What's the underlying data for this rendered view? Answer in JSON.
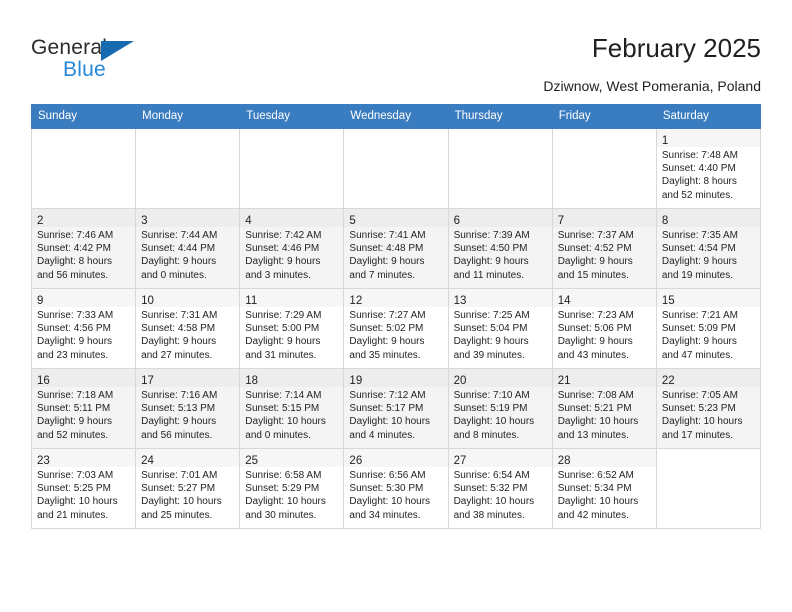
{
  "brand": {
    "name_top": "General",
    "name_bottom": "Blue",
    "accent_color": "#2787d6",
    "triangle_color": "#1769b0"
  },
  "header": {
    "title": "February 2025",
    "subtitle": "Dziwnow, West Pomerania, Poland"
  },
  "calendar": {
    "header_bg": "#3a7cc0",
    "weekday_headers": [
      "Sunday",
      "Monday",
      "Tuesday",
      "Wednesday",
      "Thursday",
      "Friday",
      "Saturday"
    ],
    "weeks": [
      [
        {
          "day": "",
          "lines": []
        },
        {
          "day": "",
          "lines": []
        },
        {
          "day": "",
          "lines": []
        },
        {
          "day": "",
          "lines": []
        },
        {
          "day": "",
          "lines": []
        },
        {
          "day": "",
          "lines": []
        },
        {
          "day": "1",
          "lines": [
            "Sunrise: 7:48 AM",
            "Sunset: 4:40 PM",
            "Daylight: 8 hours",
            "and 52 minutes."
          ]
        }
      ],
      [
        {
          "day": "2",
          "lines": [
            "Sunrise: 7:46 AM",
            "Sunset: 4:42 PM",
            "Daylight: 8 hours",
            "and 56 minutes."
          ]
        },
        {
          "day": "3",
          "lines": [
            "Sunrise: 7:44 AM",
            "Sunset: 4:44 PM",
            "Daylight: 9 hours",
            "and 0 minutes."
          ]
        },
        {
          "day": "4",
          "lines": [
            "Sunrise: 7:42 AM",
            "Sunset: 4:46 PM",
            "Daylight: 9 hours",
            "and 3 minutes."
          ]
        },
        {
          "day": "5",
          "lines": [
            "Sunrise: 7:41 AM",
            "Sunset: 4:48 PM",
            "Daylight: 9 hours",
            "and 7 minutes."
          ]
        },
        {
          "day": "6",
          "lines": [
            "Sunrise: 7:39 AM",
            "Sunset: 4:50 PM",
            "Daylight: 9 hours",
            "and 11 minutes."
          ]
        },
        {
          "day": "7",
          "lines": [
            "Sunrise: 7:37 AM",
            "Sunset: 4:52 PM",
            "Daylight: 9 hours",
            "and 15 minutes."
          ]
        },
        {
          "day": "8",
          "lines": [
            "Sunrise: 7:35 AM",
            "Sunset: 4:54 PM",
            "Daylight: 9 hours",
            "and 19 minutes."
          ]
        }
      ],
      [
        {
          "day": "9",
          "lines": [
            "Sunrise: 7:33 AM",
            "Sunset: 4:56 PM",
            "Daylight: 9 hours",
            "and 23 minutes."
          ]
        },
        {
          "day": "10",
          "lines": [
            "Sunrise: 7:31 AM",
            "Sunset: 4:58 PM",
            "Daylight: 9 hours",
            "and 27 minutes."
          ]
        },
        {
          "day": "11",
          "lines": [
            "Sunrise: 7:29 AM",
            "Sunset: 5:00 PM",
            "Daylight: 9 hours",
            "and 31 minutes."
          ]
        },
        {
          "day": "12",
          "lines": [
            "Sunrise: 7:27 AM",
            "Sunset: 5:02 PM",
            "Daylight: 9 hours",
            "and 35 minutes."
          ]
        },
        {
          "day": "13",
          "lines": [
            "Sunrise: 7:25 AM",
            "Sunset: 5:04 PM",
            "Daylight: 9 hours",
            "and 39 minutes."
          ]
        },
        {
          "day": "14",
          "lines": [
            "Sunrise: 7:23 AM",
            "Sunset: 5:06 PM",
            "Daylight: 9 hours",
            "and 43 minutes."
          ]
        },
        {
          "day": "15",
          "lines": [
            "Sunrise: 7:21 AM",
            "Sunset: 5:09 PM",
            "Daylight: 9 hours",
            "and 47 minutes."
          ]
        }
      ],
      [
        {
          "day": "16",
          "lines": [
            "Sunrise: 7:18 AM",
            "Sunset: 5:11 PM",
            "Daylight: 9 hours",
            "and 52 minutes."
          ]
        },
        {
          "day": "17",
          "lines": [
            "Sunrise: 7:16 AM",
            "Sunset: 5:13 PM",
            "Daylight: 9 hours",
            "and 56 minutes."
          ]
        },
        {
          "day": "18",
          "lines": [
            "Sunrise: 7:14 AM",
            "Sunset: 5:15 PM",
            "Daylight: 10 hours",
            "and 0 minutes."
          ]
        },
        {
          "day": "19",
          "lines": [
            "Sunrise: 7:12 AM",
            "Sunset: 5:17 PM",
            "Daylight: 10 hours",
            "and 4 minutes."
          ]
        },
        {
          "day": "20",
          "lines": [
            "Sunrise: 7:10 AM",
            "Sunset: 5:19 PM",
            "Daylight: 10 hours",
            "and 8 minutes."
          ]
        },
        {
          "day": "21",
          "lines": [
            "Sunrise: 7:08 AM",
            "Sunset: 5:21 PM",
            "Daylight: 10 hours",
            "and 13 minutes."
          ]
        },
        {
          "day": "22",
          "lines": [
            "Sunrise: 7:05 AM",
            "Sunset: 5:23 PM",
            "Daylight: 10 hours",
            "and 17 minutes."
          ]
        }
      ],
      [
        {
          "day": "23",
          "lines": [
            "Sunrise: 7:03 AM",
            "Sunset: 5:25 PM",
            "Daylight: 10 hours",
            "and 21 minutes."
          ]
        },
        {
          "day": "24",
          "lines": [
            "Sunrise: 7:01 AM",
            "Sunset: 5:27 PM",
            "Daylight: 10 hours",
            "and 25 minutes."
          ]
        },
        {
          "day": "25",
          "lines": [
            "Sunrise: 6:58 AM",
            "Sunset: 5:29 PM",
            "Daylight: 10 hours",
            "and 30 minutes."
          ]
        },
        {
          "day": "26",
          "lines": [
            "Sunrise: 6:56 AM",
            "Sunset: 5:30 PM",
            "Daylight: 10 hours",
            "and 34 minutes."
          ]
        },
        {
          "day": "27",
          "lines": [
            "Sunrise: 6:54 AM",
            "Sunset: 5:32 PM",
            "Daylight: 10 hours",
            "and 38 minutes."
          ]
        },
        {
          "day": "28",
          "lines": [
            "Sunrise: 6:52 AM",
            "Sunset: 5:34 PM",
            "Daylight: 10 hours",
            "and 42 minutes."
          ]
        },
        {
          "day": "",
          "lines": []
        }
      ]
    ]
  }
}
